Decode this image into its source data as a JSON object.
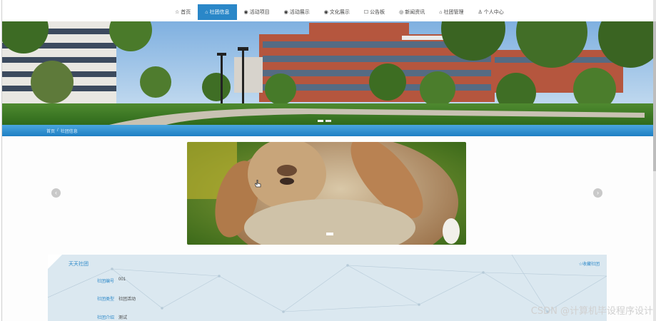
{
  "nav": {
    "items": [
      {
        "icon": "☆",
        "icon_name": "star-icon",
        "label": "首页"
      },
      {
        "icon": "⌂",
        "icon_name": "home-icon",
        "label": "社团信息",
        "active": true
      },
      {
        "icon": "◉",
        "icon_name": "circle-icon",
        "label": "活动项目"
      },
      {
        "icon": "◉",
        "icon_name": "circle-icon",
        "label": "活动展示"
      },
      {
        "icon": "◉",
        "icon_name": "circle-icon",
        "label": "文化展示"
      },
      {
        "icon": "☐",
        "icon_name": "notice-icon",
        "label": "公告板"
      },
      {
        "icon": "◎",
        "icon_name": "compass-icon",
        "label": "新闻资讯"
      },
      {
        "icon": "⌂",
        "icon_name": "home-icon",
        "label": "社团管理"
      },
      {
        "icon": "♙",
        "icon_name": "user-icon",
        "label": "个人中心"
      }
    ]
  },
  "breadcrumb": {
    "home": "首页",
    "separator": "/",
    "current": "社团信息"
  },
  "card": {
    "title": "天天社团",
    "favorite_label": "☆收藏社团",
    "rows": [
      {
        "key": "社团编号",
        "value": "001"
      },
      {
        "key": "社团类型",
        "value": "社团活动"
      },
      {
        "key": "社团介绍",
        "value": "测试"
      }
    ]
  },
  "watermark": "CSDN @计算机毕设程序设计",
  "colors": {
    "accent": "#2a87c8",
    "card_bg": "#dbe8f0"
  }
}
